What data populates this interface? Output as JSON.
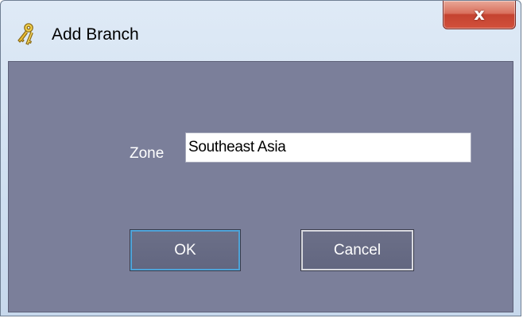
{
  "window": {
    "title": "Add Branch",
    "close_glyph": "x",
    "icon": "keys-icon"
  },
  "form": {
    "zone_label": "Zone",
    "zone_value": "Southeast Asia"
  },
  "buttons": {
    "ok_label": "OK",
    "cancel_label": "Cancel"
  },
  "colors": {
    "client_background": "#7b7f9a",
    "button_background": "#666a84",
    "ok_focus_border": "#4ea3d8",
    "close_button": "#c44330"
  }
}
